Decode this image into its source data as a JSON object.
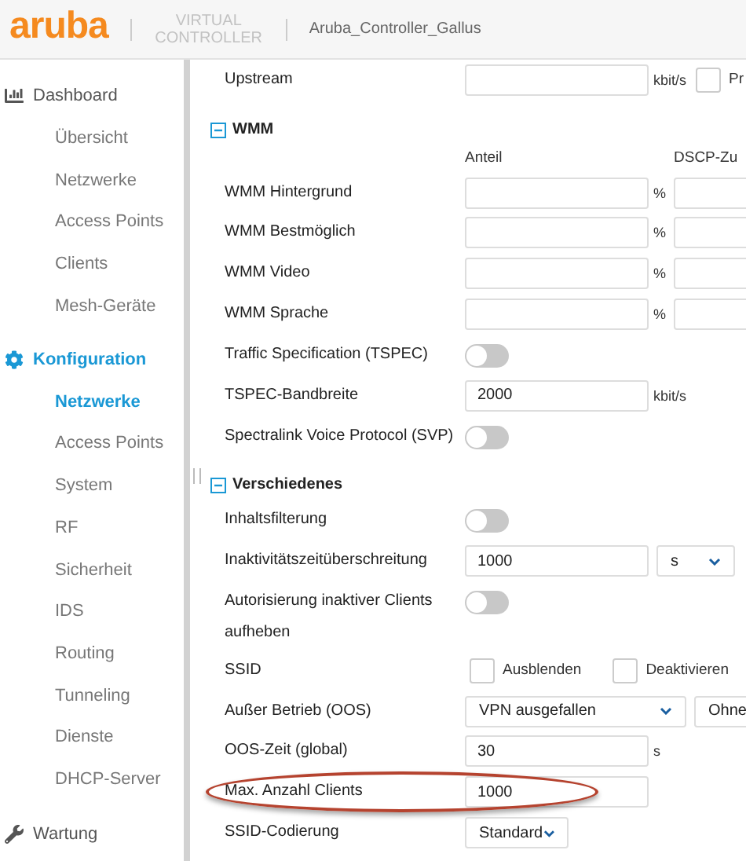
{
  "header": {
    "logo": "aruba",
    "product": "VIRTUAL CONTROLLER",
    "controller_name": "Aruba_Controller_Gallus"
  },
  "sidebar": [
    {
      "label": "Dashboard",
      "active": false,
      "children": [
        {
          "label": "Übersicht",
          "selected": false
        },
        {
          "label": "Netzwerke",
          "selected": false
        },
        {
          "label": "Access Points",
          "selected": false
        },
        {
          "label": "Clients",
          "selected": false
        },
        {
          "label": "Mesh-Geräte",
          "selected": false
        }
      ]
    },
    {
      "label": "Konfiguration",
      "active": true,
      "children": [
        {
          "label": "Netzwerke",
          "selected": true
        },
        {
          "label": "Access Points",
          "selected": false
        },
        {
          "label": "System",
          "selected": false
        },
        {
          "label": "RF",
          "selected": false
        },
        {
          "label": "Sicherheit",
          "selected": false
        },
        {
          "label": "IDS",
          "selected": false
        },
        {
          "label": "Routing",
          "selected": false
        },
        {
          "label": "Tunneling",
          "selected": false
        },
        {
          "label": "Dienste",
          "selected": false
        },
        {
          "label": "DHCP-Server",
          "selected": false
        }
      ]
    },
    {
      "label": "Wartung",
      "active": false
    }
  ],
  "content": [
    {
      "kind": "input",
      "label": "Upstream",
      "unit": "kbit/s",
      "checkbox": {
        "checked": false,
        "label": "Pr"
      }
    },
    {
      "kind": "section",
      "title": "WMM",
      "expanded": true
    },
    {
      "kind": "columns",
      "labels": [
        "Anteil",
        "DSCP-Zu"
      ]
    },
    {
      "kind": "input",
      "label": "WMM Hintergrund",
      "unit": "%",
      "second_field": true
    },
    {
      "kind": "input",
      "label": "WMM Bestmöglich",
      "unit": "%",
      "second_field": true
    },
    {
      "kind": "input",
      "label": "WMM Video",
      "unit": "%",
      "second_field": true
    },
    {
      "kind": "input",
      "label": "WMM Sprache",
      "unit": "%",
      "second_field": true
    },
    {
      "kind": "toggle",
      "label": "Traffic Specification (TSPEC)",
      "on": false
    },
    {
      "kind": "input",
      "label": "TSPEC-Bandbreite",
      "value": "2000",
      "unit": "kbit/s"
    },
    {
      "kind": "toggle",
      "label": "Spectralink Voice Protocol (SVP)",
      "on": false
    },
    {
      "kind": "section",
      "title": "Verschiedenes",
      "expanded": true
    },
    {
      "kind": "toggle",
      "label": "Inhaltsfilterung",
      "on": false
    },
    {
      "kind": "input",
      "label": "Inaktivitätszeitüberschreitung",
      "value": "1000",
      "unit_select": "s"
    },
    {
      "kind": "toggle",
      "label": "Autorisierung inaktiver Clients aufheben",
      "on": false
    },
    {
      "kind": "checks",
      "label": "SSID",
      "items": [
        {
          "label": "Ausblenden",
          "checked": false
        },
        {
          "label": "Deaktivieren",
          "checked": false
        }
      ]
    },
    {
      "kind": "select",
      "label": "Außer Betrieb (OOS)",
      "value": "VPN ausgefallen",
      "second_select": "Ohne"
    },
    {
      "kind": "input",
      "label": "OOS-Zeit (global)",
      "value": "30",
      "unit": "s"
    },
    {
      "kind": "input",
      "label": "Max. Anzahl Clients",
      "value": "1000",
      "highlighted": true
    },
    {
      "kind": "select",
      "label": "SSID-Codierung",
      "value": "Standard",
      "narrow": true
    }
  ]
}
